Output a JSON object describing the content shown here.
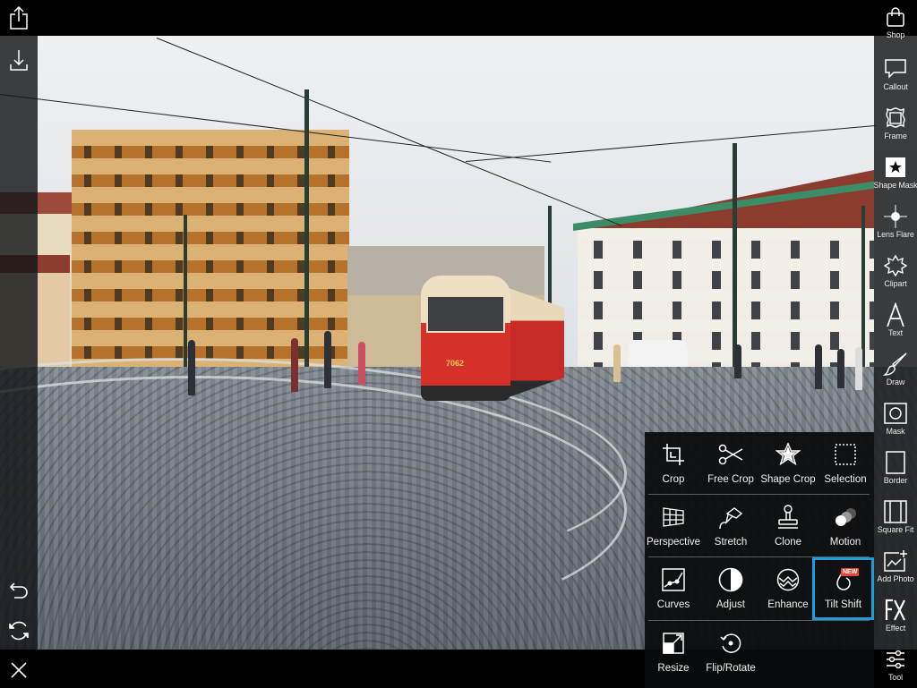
{
  "left_toolbar": {
    "items": [
      {
        "name": "share",
        "icon": "share-icon"
      },
      {
        "name": "save",
        "icon": "download-icon"
      },
      {
        "name": "undo",
        "icon": "undo-icon"
      },
      {
        "name": "redo",
        "icon": "redo-icon"
      },
      {
        "name": "close",
        "icon": "close-icon"
      }
    ]
  },
  "right_toolbar": {
    "items": [
      {
        "label": "Shop",
        "icon": "shop-bag-icon"
      },
      {
        "label": "Callout",
        "icon": "callout-icon"
      },
      {
        "label": "Frame",
        "icon": "frame-icon"
      },
      {
        "label": "Shape Mask",
        "icon": "shape-mask-icon"
      },
      {
        "label": "Lens Flare",
        "icon": "lens-flare-icon"
      },
      {
        "label": "Clipart",
        "icon": "clipart-icon"
      },
      {
        "label": "Text",
        "icon": "text-icon"
      },
      {
        "label": "Draw",
        "icon": "brush-icon"
      },
      {
        "label": "Mask",
        "icon": "mask-icon"
      },
      {
        "label": "Border",
        "icon": "border-icon"
      },
      {
        "label": "Square Fit",
        "icon": "square-fit-icon"
      },
      {
        "label": "Add Photo",
        "icon": "add-photo-icon"
      },
      {
        "label": "Effect",
        "icon": "fx-icon"
      },
      {
        "label": "Tool",
        "icon": "sliders-icon"
      }
    ]
  },
  "tools_panel": {
    "rows": [
      [
        {
          "label": "Crop",
          "icon": "crop-icon"
        },
        {
          "label": "Free Crop",
          "icon": "scissors-icon"
        },
        {
          "label": "Shape Crop",
          "icon": "star-icon"
        },
        {
          "label": "Selection",
          "icon": "selection-icon"
        }
      ],
      [
        {
          "label": "Perspective",
          "icon": "perspective-grid-icon"
        },
        {
          "label": "Stretch",
          "icon": "stretch-icon"
        },
        {
          "label": "Clone",
          "icon": "stamp-icon"
        },
        {
          "label": "Motion",
          "icon": "motion-icon"
        }
      ],
      [
        {
          "label": "Curves",
          "icon": "curves-icon"
        },
        {
          "label": "Adjust",
          "icon": "contrast-icon"
        },
        {
          "label": "Enhance",
          "icon": "enhance-icon"
        },
        {
          "label": "Tilt Shift",
          "icon": "droplet-icon",
          "badge": "NEW",
          "selected": true
        }
      ],
      [
        {
          "label": "Resize",
          "icon": "resize-icon"
        },
        {
          "label": "Flip/Rotate",
          "icon": "rotate-icon"
        }
      ]
    ],
    "selected_color": "#1e9ed8",
    "badge_color": "#e8452f"
  },
  "photo": {
    "description": "Street scene with red and cream tram on cobblestone square",
    "tram_number": "7062"
  }
}
